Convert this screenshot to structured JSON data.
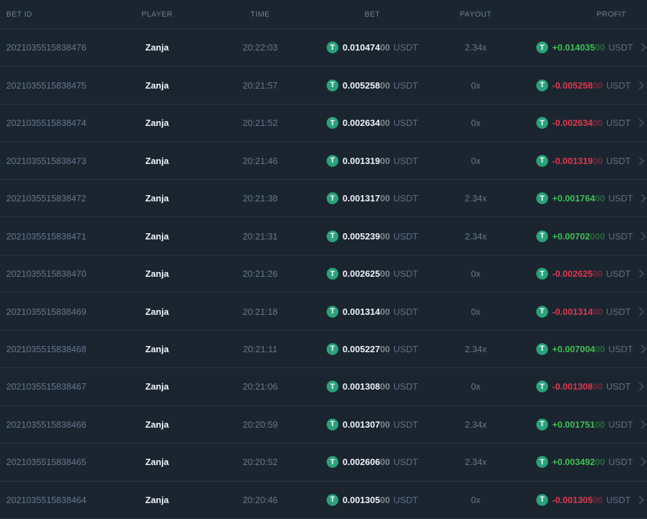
{
  "table": {
    "columns": [
      "BET ID",
      "PLAYER",
      "TIME",
      "BET",
      "PAYOUT",
      "PROFIT"
    ],
    "currency": "USDT",
    "rows": [
      {
        "bet_id": "2021035515838476",
        "player": "Zanja",
        "time": "20:22:03",
        "bet_main": "0.010474",
        "bet_zeros": "00",
        "payout": "2.34x",
        "profit_main": "+0.014035",
        "profit_zeros": "00",
        "result": "win"
      },
      {
        "bet_id": "2021035515838475",
        "player": "Zanja",
        "time": "20:21:57",
        "bet_main": "0.005258",
        "bet_zeros": "00",
        "payout": "0x",
        "profit_main": "-0.005258",
        "profit_zeros": "00",
        "result": "loss"
      },
      {
        "bet_id": "2021035515838474",
        "player": "Zanja",
        "time": "20:21:52",
        "bet_main": "0.002634",
        "bet_zeros": "00",
        "payout": "0x",
        "profit_main": "-0.002634",
        "profit_zeros": "00",
        "result": "loss"
      },
      {
        "bet_id": "2021035515838473",
        "player": "Zanja",
        "time": "20:21:46",
        "bet_main": "0.001319",
        "bet_zeros": "00",
        "payout": "0x",
        "profit_main": "-0.001319",
        "profit_zeros": "00",
        "result": "loss"
      },
      {
        "bet_id": "2021035515838472",
        "player": "Zanja",
        "time": "20:21:38",
        "bet_main": "0.001317",
        "bet_zeros": "00",
        "payout": "2.34x",
        "profit_main": "+0.001764",
        "profit_zeros": "00",
        "result": "win"
      },
      {
        "bet_id": "2021035515838471",
        "player": "Zanja",
        "time": "20:21:31",
        "bet_main": "0.005239",
        "bet_zeros": "00",
        "payout": "2.34x",
        "profit_main": "+0.00702",
        "profit_zeros": "000",
        "result": "win"
      },
      {
        "bet_id": "2021035515838470",
        "player": "Zanja",
        "time": "20:21:26",
        "bet_main": "0.002625",
        "bet_zeros": "00",
        "payout": "0x",
        "profit_main": "-0.002625",
        "profit_zeros": "00",
        "result": "loss"
      },
      {
        "bet_id": "2021035515838469",
        "player": "Zanja",
        "time": "20:21:18",
        "bet_main": "0.001314",
        "bet_zeros": "00",
        "payout": "0x",
        "profit_main": "-0.001314",
        "profit_zeros": "00",
        "result": "loss"
      },
      {
        "bet_id": "2021035515838468",
        "player": "Zanja",
        "time": "20:21:11",
        "bet_main": "0.005227",
        "bet_zeros": "00",
        "payout": "2.34x",
        "profit_main": "+0.007004",
        "profit_zeros": "00",
        "result": "win"
      },
      {
        "bet_id": "2021035515838467",
        "player": "Zanja",
        "time": "20:21:06",
        "bet_main": "0.001308",
        "bet_zeros": "00",
        "payout": "0x",
        "profit_main": "-0.001308",
        "profit_zeros": "00",
        "result": "loss"
      },
      {
        "bet_id": "2021035515838466",
        "player": "Zanja",
        "time": "20:20:59",
        "bet_main": "0.001307",
        "bet_zeros": "00",
        "payout": "2.34x",
        "profit_main": "+0.001751",
        "profit_zeros": "00",
        "result": "win"
      },
      {
        "bet_id": "2021035515838465",
        "player": "Zanja",
        "time": "20:20:52",
        "bet_main": "0.002606",
        "bet_zeros": "00",
        "payout": "2.34x",
        "profit_main": "+0.003492",
        "profit_zeros": "00",
        "result": "win"
      },
      {
        "bet_id": "2021035515838464",
        "player": "Zanja",
        "time": "20:20:46",
        "bet_main": "0.001305",
        "bet_zeros": "00",
        "payout": "0x",
        "profit_main": "-0.001305",
        "profit_zeros": "00",
        "result": "loss"
      }
    ]
  },
  "icons": {
    "tether_glyph": "T",
    "chevron_right": "css-shape"
  },
  "colors": {
    "background": "#1b2530",
    "divider": "#2a3645",
    "muted_text": "#65788d",
    "header_text": "#6c8096",
    "white_text": "#f0f4f8",
    "positive": "#3fc152",
    "negative": "#e0374e",
    "tether_green": "#29a37a"
  }
}
